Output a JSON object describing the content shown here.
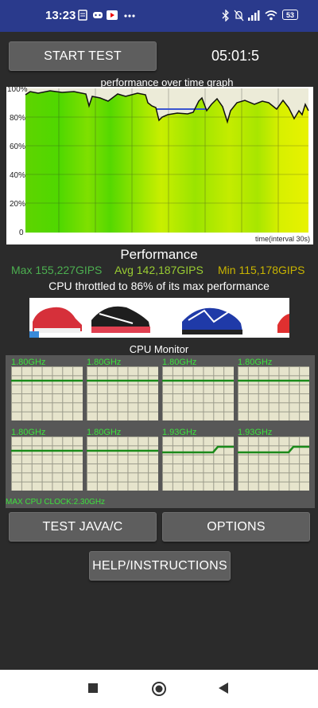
{
  "status_bar": {
    "time": "13:23",
    "battery": "53"
  },
  "header": {
    "start_button": "START TEST",
    "timer": "05:01:5"
  },
  "graph": {
    "title": "performance over time graph",
    "y_ticks": [
      "100%",
      "80%",
      "60%",
      "40%",
      "20%",
      "0"
    ],
    "x_label": "time(interval 30s)"
  },
  "performance": {
    "title": "Performance",
    "max": "Max 155,227GIPS",
    "avg": "Avg 142,187GIPS",
    "min": "Min 115,178GIPS",
    "throttle": "CPU throttled to 86% of its max performance"
  },
  "cpu_monitor": {
    "title": "CPU Monitor",
    "cores": [
      {
        "freq": "1.80GHz"
      },
      {
        "freq": "1.80GHz"
      },
      {
        "freq": "1.80GHz"
      },
      {
        "freq": "1.80GHz"
      },
      {
        "freq": "1.80GHz"
      },
      {
        "freq": "1.80GHz"
      },
      {
        "freq": "1.93GHz"
      },
      {
        "freq": "1.93GHz"
      }
    ],
    "max_clock": "MAX CPU CLOCK:2.30GHz"
  },
  "buttons": {
    "test_java": "TEST JAVA/C",
    "options": "OPTIONS",
    "help": "HELP/INSTRUCTIONS"
  },
  "colors": {
    "status_bar": "#2a3a8c",
    "panel": "#575757",
    "green_text": "#3de03d",
    "max": "#4caf50",
    "avg": "#9acd32",
    "min": "#c8b400"
  }
}
